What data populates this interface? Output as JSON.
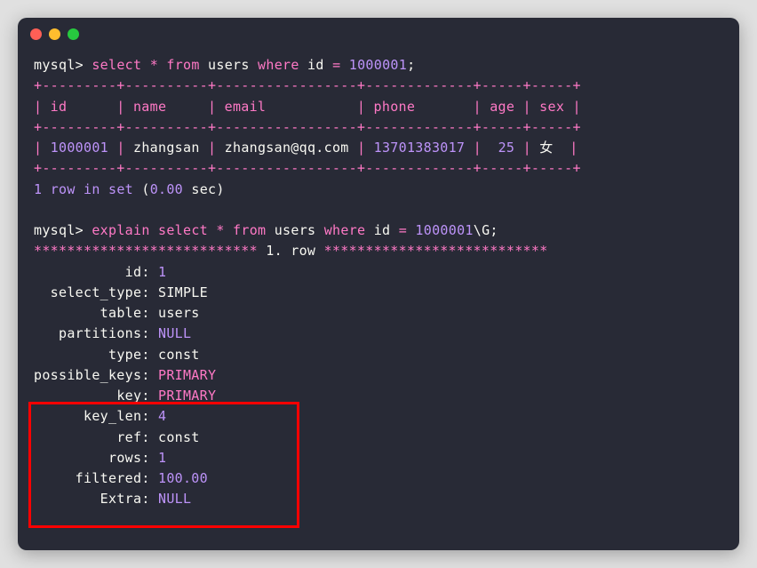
{
  "prompt": "mysql>",
  "query1": {
    "select": "select",
    "star": "*",
    "from": "from",
    "table": "users",
    "where": "where",
    "col": "id",
    "eq": "=",
    "val": "1000001",
    "semicolon": ";"
  },
  "table": {
    "border_top": "+---------+----------+-----------------+-------------+-----+-----+",
    "header": "| id      | name     | email           | phone       | age | sex |",
    "border_mid": "+---------+----------+-----------------+-------------+-----+-----+",
    "row": {
      "id": "1000001",
      "name": "zhangsan",
      "email": "zhangsan@qq.com",
      "phone": "13701383017",
      "age": "25",
      "sex": "女"
    },
    "border_bot": "+---------+----------+-----------------+-------------+-----+-----+"
  },
  "result_msg": {
    "count": "1",
    "row_in_set": "row in set",
    "time": "0.00",
    "sec": "sec"
  },
  "query2": {
    "explain": "explain",
    "select": "select",
    "star": "*",
    "from": "from",
    "table": "users",
    "where": "where",
    "col": "id",
    "eq": "=",
    "val": "1000001",
    "g": "\\G",
    "semicolon": ";"
  },
  "row_marker": {
    "stars_left": "***************************",
    "label": " 1. row ",
    "stars_right": "***************************"
  },
  "explain": {
    "id_label": "id",
    "id_val": "1",
    "select_type_label": "select_type",
    "select_type_val": "SIMPLE",
    "table_label": "table",
    "table_val": "users",
    "partitions_label": "partitions",
    "partitions_val": "NULL",
    "type_label": "type",
    "type_val": "const",
    "possible_keys_label": "possible_keys",
    "possible_keys_val": "PRIMARY",
    "key_label": "key",
    "key_val": "PRIMARY",
    "key_len_label": "key_len",
    "key_len_val": "4",
    "ref_label": "ref",
    "ref_val": "const",
    "rows_label": "rows",
    "rows_val": "1",
    "filtered_label": "filtered",
    "filtered_val": "100.00",
    "extra_label": "Extra",
    "extra_val": "NULL"
  }
}
